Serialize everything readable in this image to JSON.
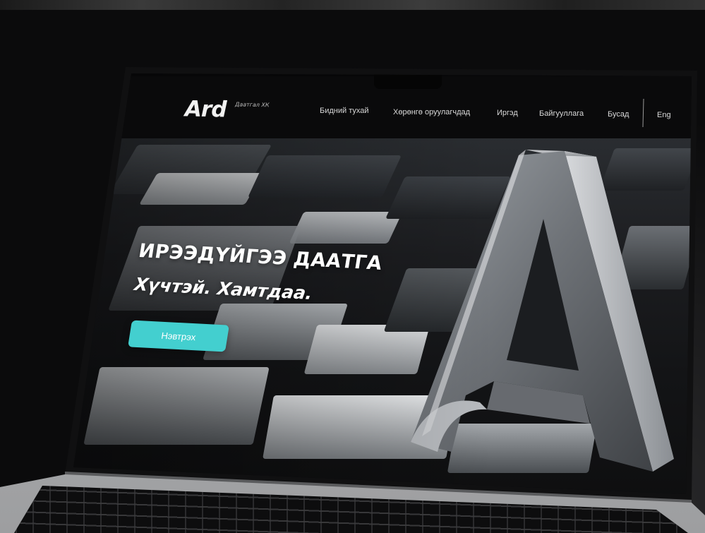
{
  "brand": {
    "name": "Ard",
    "subtitle": "Даатгал ХК"
  },
  "nav": {
    "items": [
      {
        "label": "Бидний тухай"
      },
      {
        "label": "Хөрөнгө оруулагчдад"
      },
      {
        "label": "Иргэд"
      },
      {
        "label": "Байгууллага"
      },
      {
        "label": "Бусад"
      }
    ],
    "language": "Eng"
  },
  "hero": {
    "title": "ИРЭЭДҮЙГЭЭ ДААТГА",
    "subtitle": "Хүчтэй. Хамтдаа.",
    "cta_label": "Нэвтрэх"
  },
  "colors": {
    "accent": "#43cfcf",
    "navbar_bg": "#0a0a0b",
    "text": "#ffffff"
  }
}
